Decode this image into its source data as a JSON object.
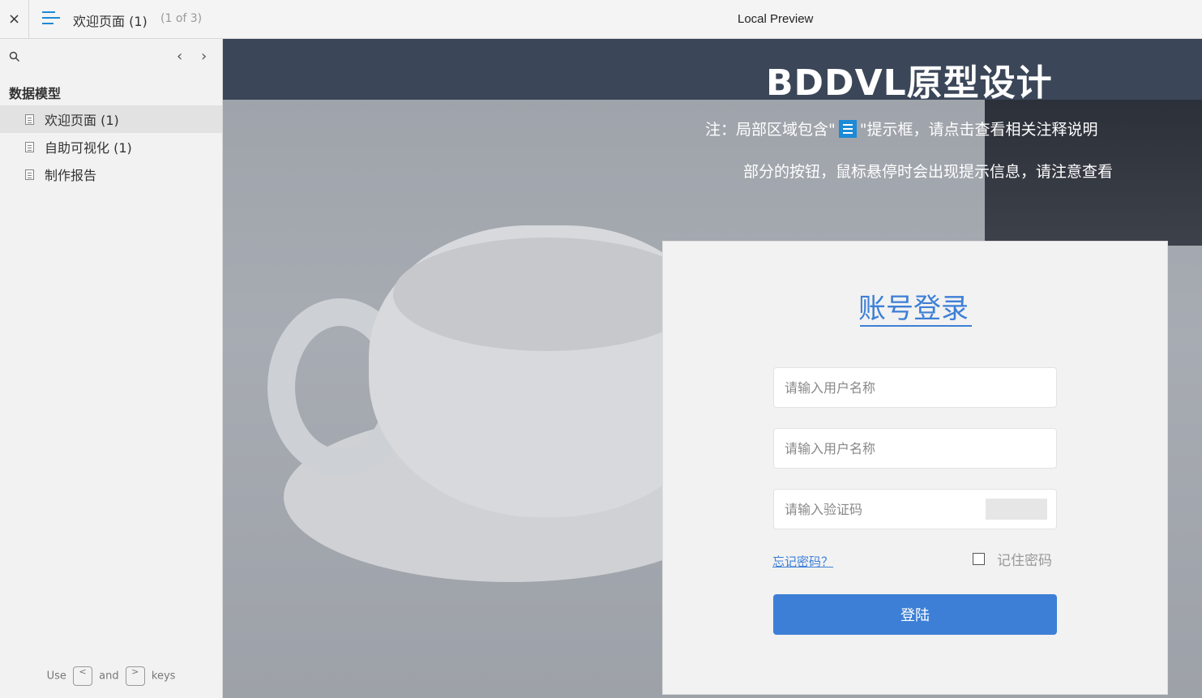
{
  "topbar": {
    "close_label": "×",
    "page_title": "欢迎页面 (1)",
    "page_counter": "(1 of 3)",
    "app_title": "Local Preview"
  },
  "sidebar": {
    "section_title": "数据模型",
    "items": [
      {
        "label": "欢迎页面 (1)",
        "active": true
      },
      {
        "label": "自助可视化 (1)",
        "active": false
      },
      {
        "label": "制作报告",
        "active": false
      }
    ],
    "footer": {
      "use": "Use",
      "and": "and",
      "keys": "keys",
      "prev_key": "<",
      "next_key": ">"
    }
  },
  "main": {
    "brand_title": "BDDVL原型设计",
    "note_line1_prefix": "注：局部区域包含\"",
    "note_line1_suffix": "\"提示框，请点击查看相关注释说明",
    "note_line2": "部分的按钮，鼠标悬停时会出现提示信息，请注意查看"
  },
  "login": {
    "title": "账号登录",
    "username_placeholder": "请输入用户名称",
    "password_placeholder": "请输入用户名称",
    "captcha_placeholder": "请输入验证码",
    "forgot_link": "忘记密码？",
    "remember_label": "记住密码",
    "remember_checked": false,
    "submit_label": "登陆",
    "accent_color": "#3d7fd6"
  }
}
